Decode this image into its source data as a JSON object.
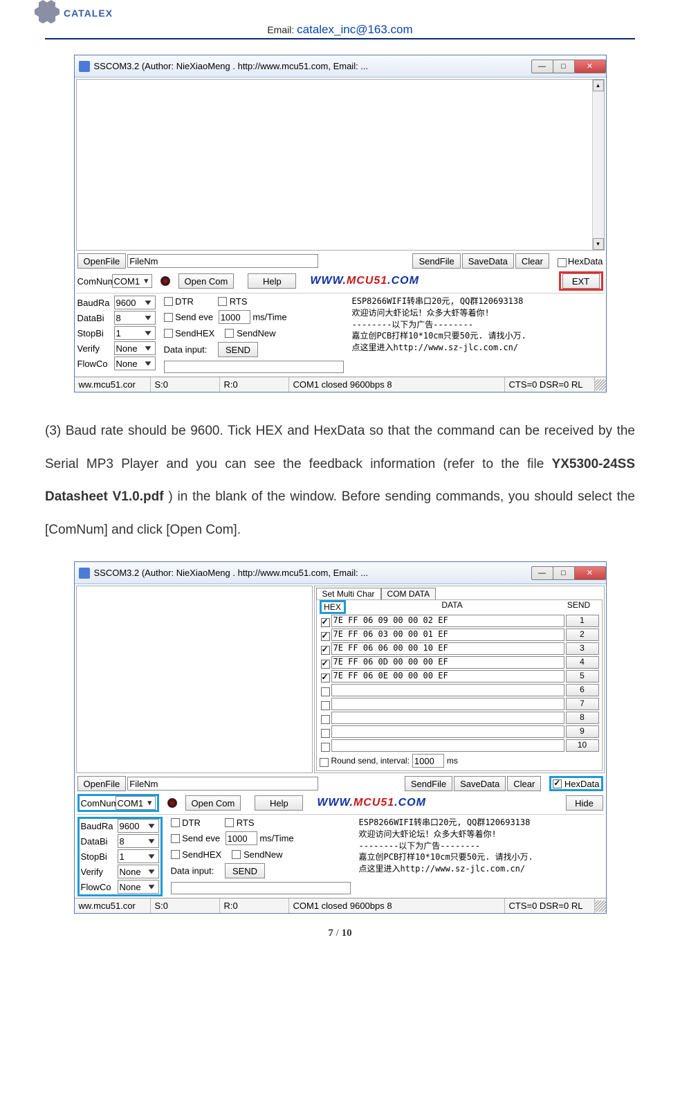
{
  "header": {
    "brand": "CATALEX",
    "email_label": "Email: ",
    "email": "catalex_inc@163.com"
  },
  "win1": {
    "title": "SSCOM3.2 (Author: NieXiaoMeng .  http://www.mcu51.com,  Email: ...",
    "file": {
      "openfile": "OpenFile",
      "filenm": "FileNm",
      "sendfile": "SendFile",
      "savedata": "SaveData",
      "clear": "Clear",
      "hexdata": "HexData"
    },
    "comrow": {
      "comnum": "ComNum",
      "comport": "COM1",
      "opencom": "Open Com",
      "help": "Help",
      "ext": "EXT"
    },
    "params": {
      "baud_l": "BaudRa",
      "baud_v": "9600",
      "databi_l": "DataBi",
      "databi_v": "8",
      "stopbi_l": "StopBi",
      "stopbi_v": "1",
      "verify_l": "Verify",
      "verify_v": "None",
      "flow_l": "FlowCo",
      "flow_v": "None",
      "dtr": "DTR",
      "rts": "RTS",
      "sendeve": "Send eve",
      "mstime": "1000",
      "mstime_u": "ms/Time",
      "sendhex": "SendHEX",
      "sendnew": "SendNew",
      "datainput": "Data input:",
      "send": "SEND"
    },
    "ad": {
      "l1": "ESP8266WIFI转串口20元, QQ群120693138",
      "l2": "欢迎访问大虾论坛！众多大虾等着你!",
      "l3": "--------以下为广告--------",
      "l4": "嘉立创PCB打样10*10cm只要50元. 请找小万.",
      "l5": "点这里进入http://www.sz-jlc.com.cn/"
    },
    "status": {
      "url": "ww.mcu51.cor",
      "s": "S:0",
      "r": "R:0",
      "comstat": "COM1 closed  9600bps  8",
      "cts": "CTS=0 DSR=0 RL"
    }
  },
  "body_text": {
    "p1a": "(3) Baud rate should be 9600. Tick HEX and HexData so that the command can be received by the Serial MP3 Player and you can see the feedback information (refer to the file ",
    "p1b": "YX5300-24SS Datasheet V1.0.pdf",
    "p1c": ") in the blank of the window. Before sending commands, you should select the [ComNum] and click [Open Com]."
  },
  "win2": {
    "title": "SSCOM3.2 (Author: NieXiaoMeng .  http://www.mcu51.com,  Email: ...",
    "mp": {
      "tab1": "Set Multi Char",
      "tab2": "COM DATA",
      "hex": "HEX",
      "data": "DATA",
      "send": "SEND",
      "rows": [
        {
          "on": true,
          "data": "7E FF 06 09 00 00 02 EF",
          "n": "1"
        },
        {
          "on": true,
          "data": "7E FF 06 03 00 00 01 EF",
          "n": "2"
        },
        {
          "on": true,
          "data": "7E FF 06 06 00 00 10 EF",
          "n": "3"
        },
        {
          "on": true,
          "data": "7E FF 06 0D 00 00 00 EF",
          "n": "4"
        },
        {
          "on": true,
          "data": "7E FF 06 0E 00 00 00 EF",
          "n": "5"
        },
        {
          "on": false,
          "data": "",
          "n": "6"
        },
        {
          "on": false,
          "data": "",
          "n": "7"
        },
        {
          "on": false,
          "data": "",
          "n": "8"
        },
        {
          "on": false,
          "data": "",
          "n": "9"
        },
        {
          "on": false,
          "data": "",
          "n": "10"
        }
      ],
      "round": "Round send, interval:",
      "round_v": "1000",
      "round_u": "ms"
    },
    "file": {
      "openfile": "OpenFile",
      "filenm": "FileNm",
      "sendfile": "SendFile",
      "savedata": "SaveData",
      "clear": "Clear",
      "hexdata": "HexData"
    },
    "comrow": {
      "comnum": "ComNum",
      "comport": "COM1",
      "opencom": "Open Com",
      "help": "Help",
      "hide": "Hide"
    },
    "status": {
      "url": "ww.mcu51.cor",
      "s": "S:0",
      "r": "R:0",
      "comstat": "COM1 closed  9600bps  8",
      "cts": "CTS=0 DSR=0 RL"
    }
  },
  "footer": {
    "cur": "7",
    "sep": " / ",
    "tot": "10"
  }
}
